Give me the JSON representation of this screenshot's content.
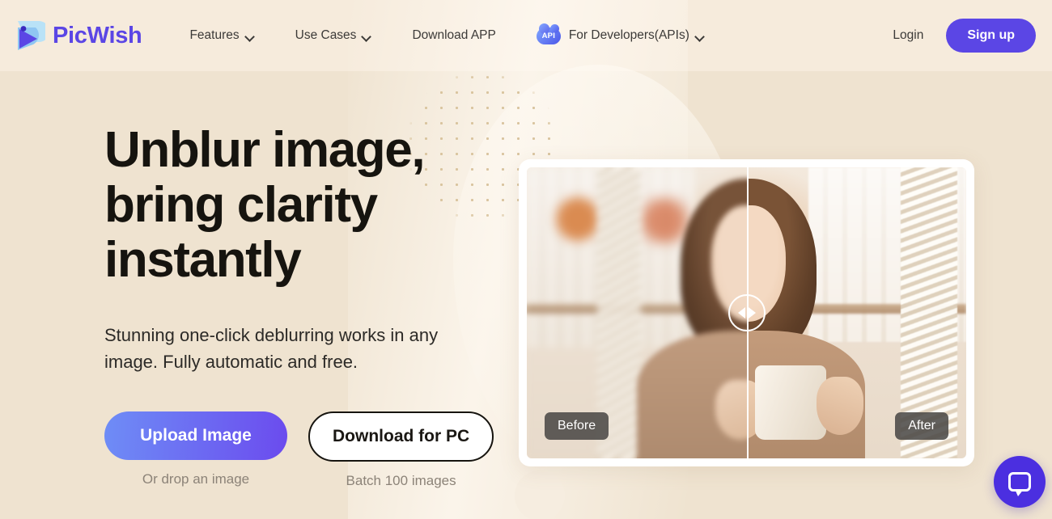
{
  "brand": {
    "name": "PicWish",
    "logo_icon": "picwish-bird-logo",
    "color": "#5B46E5"
  },
  "nav": {
    "items": [
      {
        "label": "Features",
        "has_dropdown": true,
        "icon": "chevron-down-icon"
      },
      {
        "label": "Use Cases",
        "has_dropdown": true,
        "icon": "chevron-down-icon"
      },
      {
        "label": "Download APP",
        "has_dropdown": false
      },
      {
        "label": "For Developers(APIs)",
        "has_dropdown": true,
        "badge": "API",
        "icon": "api-cloud-icon"
      }
    ],
    "login_label": "Login",
    "signup_label": "Sign up"
  },
  "hero": {
    "title_line1": "Unblur image,",
    "title_line2": "bring clarity",
    "title_line3": "instantly",
    "subtitle": "Stunning one-click deblurring works in any image. Fully automatic and free.",
    "primary_cta": "Upload Image",
    "primary_note": "Or drop an image",
    "secondary_cta": "Download for PC",
    "secondary_note": "Batch 100 images"
  },
  "comparison": {
    "before_label": "Before",
    "after_label": "After",
    "handle_icon": "slider-handle-arrows-icon",
    "image_description": "Smiling woman with wavy brown hair holding a mug in a hanging chair"
  },
  "chat": {
    "icon": "chat-bubble-icon",
    "color": "#4B2FE0"
  },
  "colors": {
    "page_background": "#EFE3D0",
    "header_background": "#F6EBDC",
    "brand_purple": "#5B46E5",
    "cta_gradient_start": "#6E8DF6",
    "cta_gradient_end": "#6B4BEE",
    "heading_text": "#16140F",
    "muted_text": "#8C8378"
  }
}
